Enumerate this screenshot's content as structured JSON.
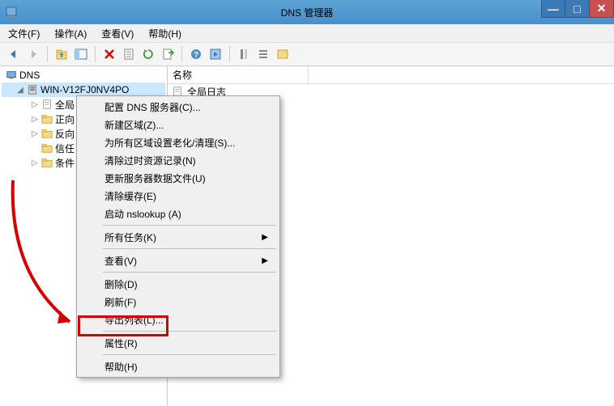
{
  "titlebar": {
    "title": "DNS 管理器"
  },
  "menubar": {
    "file": "文件(F)",
    "action": "操作(A)",
    "view": "查看(V)",
    "help": "帮助(H)"
  },
  "tree": {
    "root": "DNS",
    "server": "WIN-V12FJ0NV4PO",
    "nodes": {
      "global": "全局",
      "forward": "正向",
      "reverse": "反向",
      "trust": "信任",
      "condition": "条件"
    }
  },
  "list": {
    "col_name": "名称",
    "row0": "全局日志"
  },
  "context_menu": {
    "configure": "配置 DNS 服务器(C)...",
    "new_zone": "新建区域(Z)...",
    "aging": "为所有区域设置老化/清理(S)...",
    "scavenge": "清除过时资源记录(N)",
    "update": "更新服务器数据文件(U)",
    "clear_cache": "清除缓存(E)",
    "nslookup": "启动 nslookup (A)",
    "all_tasks": "所有任务(K)",
    "view": "查看(V)",
    "delete": "删除(D)",
    "refresh": "刷新(F)",
    "export": "导出列表(L)...",
    "properties": "属性(R)",
    "help": "帮助(H)"
  }
}
